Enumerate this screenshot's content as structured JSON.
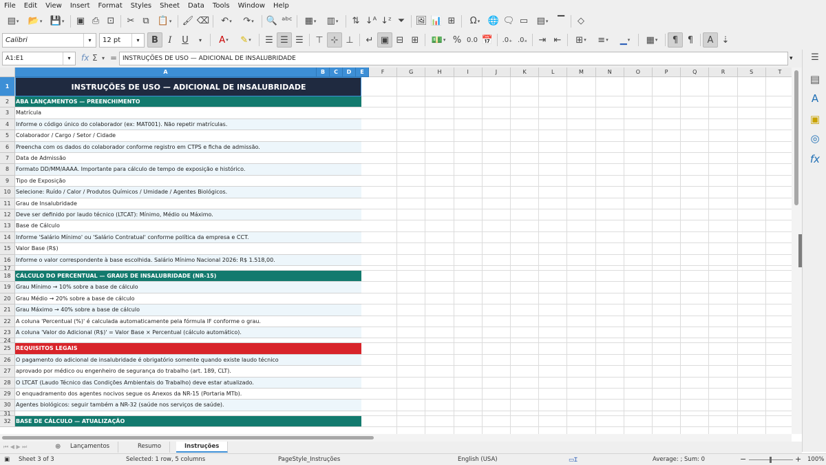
{
  "menu": [
    "File",
    "Edit",
    "View",
    "Insert",
    "Format",
    "Styles",
    "Sheet",
    "Data",
    "Tools",
    "Window",
    "Help"
  ],
  "toolbar": {
    "font_name": "Calibri",
    "font_size": "12 pt",
    "icons_row1": [
      "new-icon",
      "open-icon",
      "save-icon",
      "export-pdf-icon",
      "print-icon",
      "print-preview-icon",
      "cut-icon",
      "copy-icon",
      "paste-icon",
      "clone-formatting-icon",
      "undo-icon",
      "redo-icon",
      "find-replace-icon",
      "spelling-icon",
      "row-icon",
      "column-icon",
      "sort-icon",
      "sort-ascending-icon",
      "sort-descending-icon",
      "autofilter-icon",
      "image-icon",
      "chart-icon",
      "pivot-table-icon",
      "special-character-icon",
      "hyperlink-icon",
      "comment-icon",
      "headers-footers-icon",
      "define-print-area-icon",
      "freeze-icon",
      "split-window-icon",
      "show-draw-functions-icon"
    ],
    "bold": "B",
    "italic": "I",
    "underline": "U",
    "font_color_glyph": "A",
    "percent": "%",
    "number_format": "0.0"
  },
  "formula_bar": {
    "name_box": "A1:E1",
    "content": "INSTRUÇÕES DE USO — ADICIONAL DE INSALUBRIDADE"
  },
  "columns": [
    "A",
    "B",
    "C",
    "D",
    "E",
    "F",
    "G",
    "H",
    "I",
    "J",
    "K",
    "L",
    "M",
    "N",
    "O",
    "P",
    "Q",
    "R",
    "S",
    "T"
  ],
  "rows": [
    {
      "n": "1",
      "text": "INSTRUÇÕES DE USO — ADICIONAL DE INSALUBRIDADE",
      "style": "title"
    },
    {
      "n": "2",
      "text": "ABA LANÇAMENTOS — PREENCHIMENTO",
      "style": "teal"
    },
    {
      "n": "3",
      "text": "Matrícula",
      "style": "plain"
    },
    {
      "n": "4",
      "text": "Informe o código único do colaborador (ex: MAT001). Não repetir matrículas.",
      "style": "alt"
    },
    {
      "n": "5",
      "text": "Colaborador / Cargo / Setor / Cidade",
      "style": "plain"
    },
    {
      "n": "6",
      "text": "Preencha com os dados do colaborador conforme registro em CTPS e ficha de admissão.",
      "style": "alt"
    },
    {
      "n": "7",
      "text": "Data de Admissão",
      "style": "plain"
    },
    {
      "n": "8",
      "text": "Formato DD/MM/AAAA. Importante para cálculo de tempo de exposição e histórico.",
      "style": "alt"
    },
    {
      "n": "9",
      "text": "Tipo de Exposição",
      "style": "plain"
    },
    {
      "n": "10",
      "text": "Selecione: Ruído / Calor / Produtos Químicos / Umidade / Agentes Biológicos.",
      "style": "alt"
    },
    {
      "n": "11",
      "text": "Grau de Insalubridade",
      "style": "plain"
    },
    {
      "n": "12",
      "text": "Deve ser definido por laudo técnico (LTCAT): Mínimo, Médio ou Máximo.",
      "style": "alt"
    },
    {
      "n": "13",
      "text": "Base de Cálculo",
      "style": "plain"
    },
    {
      "n": "14",
      "text": "Informe 'Salário Mínimo' ou 'Salário Contratual' conforme política da empresa e CCT.",
      "style": "alt"
    },
    {
      "n": "15",
      "text": "Valor Base (R$)",
      "style": "plain"
    },
    {
      "n": "16",
      "text": "Informe o valor correspondente à base escolhida. Salário Mínimo Nacional 2026: R$ 1.518,00.",
      "style": "alt"
    },
    {
      "n": "17",
      "text": "",
      "style": "plain"
    },
    {
      "n": "18",
      "text": "CÁLCULO DO PERCENTUAL — GRAUS DE INSALUBRIDADE (NR-15)",
      "style": "teal"
    },
    {
      "n": "19",
      "text": "Grau Mínimo   → 10% sobre a base de cálculo",
      "style": "alt"
    },
    {
      "n": "20",
      "text": "Grau Médio    → 20% sobre a base de cálculo",
      "style": "plain"
    },
    {
      "n": "21",
      "text": "Grau Máximo   → 40% sobre a base de cálculo",
      "style": "alt"
    },
    {
      "n": "22",
      "text": "A coluna 'Percentual (%)' é calculada automaticamente pela fórmula IF conforme o grau.",
      "style": "plain"
    },
    {
      "n": "23",
      "text": "A coluna 'Valor do Adicional (R$)' = Valor Base × Percentual (cálculo automático).",
      "style": "alt"
    },
    {
      "n": "24",
      "text": "",
      "style": "plain"
    },
    {
      "n": "25",
      "text": "REQUISITOS LEGAIS",
      "style": "red"
    },
    {
      "n": "26",
      "text": "O pagamento do adicional de insalubridade é obrigatório somente quando existe laudo técnico",
      "style": "alt"
    },
    {
      "n": "27",
      "text": "aprovado por médico ou engenheiro de segurança do trabalho (art. 189, CLT).",
      "style": "plain"
    },
    {
      "n": "28",
      "text": "O LTCAT (Laudo Técnico das Condições Ambientais do Trabalho) deve estar atualizado.",
      "style": "alt"
    },
    {
      "n": "29",
      "text": "O enquadramento dos agentes nocivos segue os Anexos da NR-15 (Portaria MTb).",
      "style": "plain"
    },
    {
      "n": "30",
      "text": "Agentes biológicos: seguir também a NR-32 (saúde nos serviços de saúde).",
      "style": "alt"
    },
    {
      "n": "31",
      "text": "",
      "style": "plain"
    },
    {
      "n": "32",
      "text": "BASE DE CÁLCULO — ATUALIZAÇÃO",
      "style": "teal"
    }
  ],
  "sheet_tabs": [
    "Lançamentos",
    "Resumo",
    "Instruções"
  ],
  "active_tab": "Instruções",
  "status": {
    "sheet": "Sheet 3 of 3",
    "selection": "Selected: 1 row, 5 columns",
    "page_style": "PageStyle_Instruções",
    "language": "English (USA)",
    "summary": "Average: ; Sum: 0",
    "zoom": "100%"
  },
  "colors": {
    "title_bg": "#1f2a40",
    "teal": "#137a6e",
    "red": "#d8242a",
    "alt_row": "#edf6fb",
    "selection": "#3d8fd6"
  }
}
